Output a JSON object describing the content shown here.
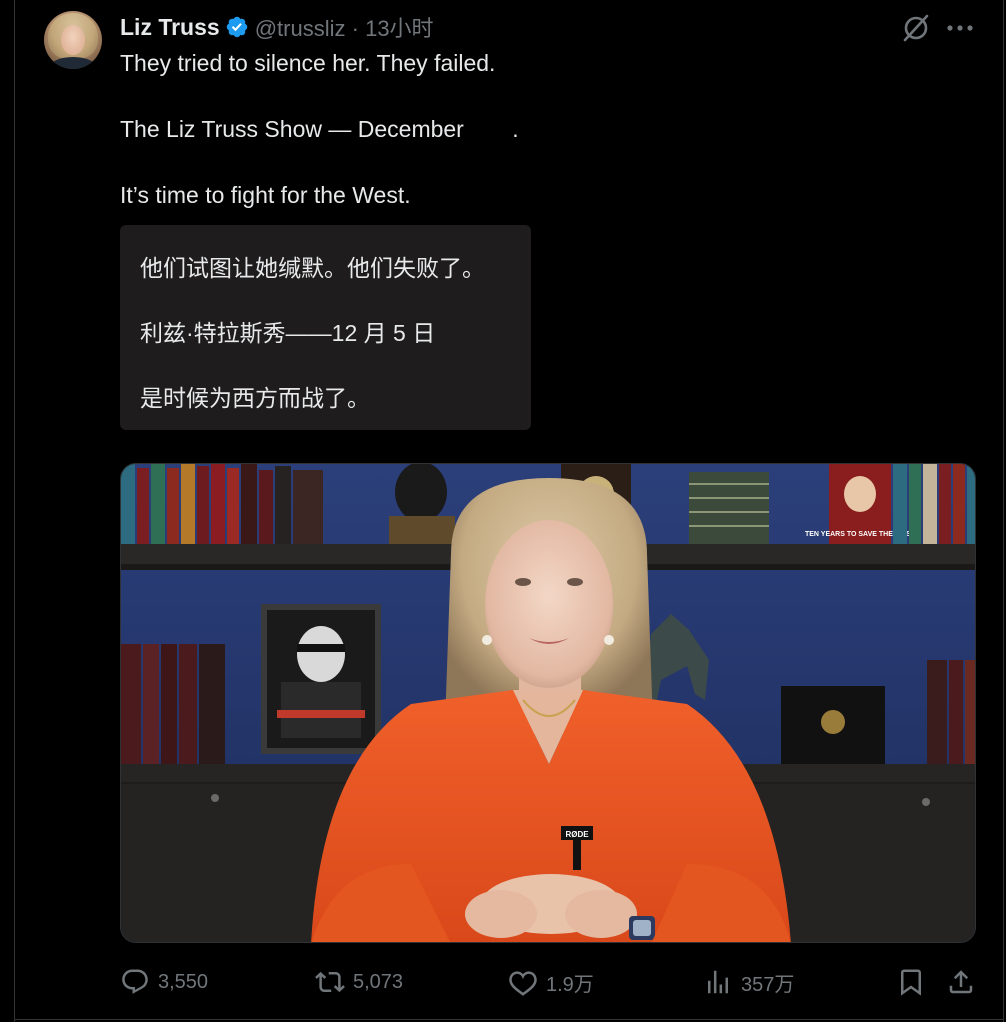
{
  "tweet": {
    "author_name": "Liz Truss",
    "handle": "@trussliz",
    "separator": "·",
    "time_ago": "13小时",
    "lines": [
      "They tried to silence her. They failed.",
      "The Liz Truss Show — December",
      "It’s time to fight for the West."
    ],
    "line2_suffix": "."
  },
  "translation": {
    "lines": [
      "他们试图让她缄默。他们失败了。",
      "利兹·特拉斯秀——12 月 5 日",
      "是时候为西方而战了。"
    ]
  },
  "media": {
    "badge_text": "RØDE",
    "book_title": "TEN YEARS TO SAVE THE WEST"
  },
  "actions": {
    "replies": "3,550",
    "retweets": "5,073",
    "likes": "1.9万",
    "views": "357万"
  },
  "icons": {
    "verified": "verified-badge-icon",
    "grok": "grok-icon",
    "more": "more-icon",
    "reply": "reply-icon",
    "retweet": "retweet-icon",
    "like": "like-icon",
    "views": "views-icon",
    "bookmark": "bookmark-icon",
    "share": "share-icon"
  },
  "colors": {
    "background": "#000000",
    "text": "#e7e9ea",
    "secondary": "#71767b",
    "verified": "#1d9bf0",
    "translation_bg": "#1e1c1d",
    "jacket": "#e8521d"
  }
}
